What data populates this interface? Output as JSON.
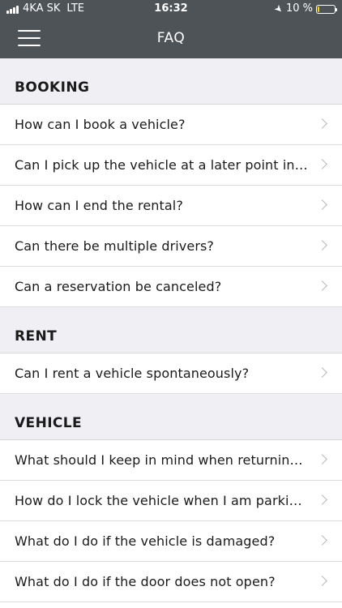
{
  "status_bar": {
    "carrier": "4KA SK",
    "network": "LTE",
    "time": "16:32",
    "battery_pct": "10 %",
    "battery_color": "#f5d90a",
    "battery_level": 0.1
  },
  "nav": {
    "title": "FAQ",
    "menu_icon": "hamburger-menu-icon"
  },
  "sections": [
    {
      "title": "BOOKING",
      "items": [
        "How can I book a vehicle?",
        "Can I pick up the vehicle at a later point in t...",
        "How can I end the rental?",
        "Can there be multiple drivers?",
        "Can a reservation be canceled?"
      ]
    },
    {
      "title": "RENT",
      "items": [
        "Can I rent a vehicle spontaneously?"
      ]
    },
    {
      "title": "VEHICLE",
      "items": [
        "What should I keep in mind when returning...",
        "How do I lock the vehicle when I am parking?",
        "What do I do if the vehicle is damaged?",
        "What do I do if the door does not open?"
      ]
    }
  ],
  "colors": {
    "header_bg": "#4e5358",
    "section_bg": "#efeff4",
    "chevron": "#b8b8bd"
  }
}
